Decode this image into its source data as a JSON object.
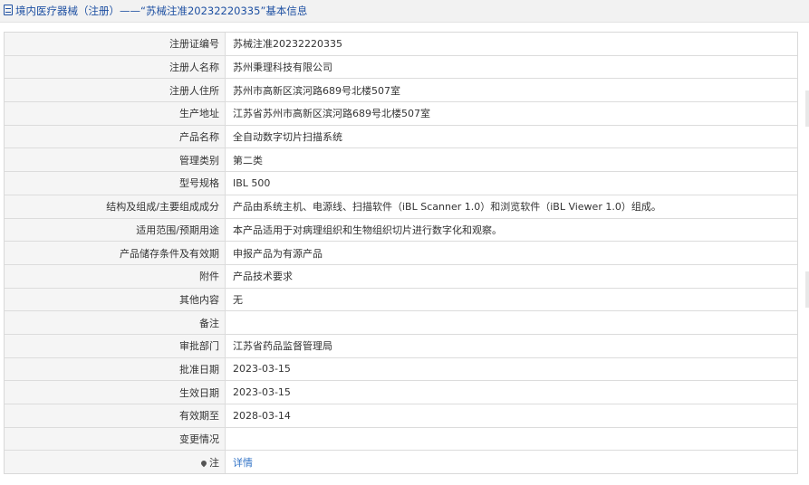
{
  "header": {
    "title": "境内医疗器械（注册）——“苏械注准20232220335”基本信息"
  },
  "rows": [
    {
      "label": "注册证编号",
      "value": "苏械注准20232220335"
    },
    {
      "label": "注册人名称",
      "value": "苏州秉理科技有限公司"
    },
    {
      "label": "注册人住所",
      "value": "苏州市高新区滨河路689号北楼507室"
    },
    {
      "label": "生产地址",
      "value": "江苏省苏州市高新区滨河路689号北楼507室"
    },
    {
      "label": "产品名称",
      "value": "全自动数字切片扫描系统"
    },
    {
      "label": "管理类别",
      "value": "第二类"
    },
    {
      "label": "型号规格",
      "value": "IBL 500"
    },
    {
      "label": "结构及组成/主要组成成分",
      "value": "产品由系统主机、电源线、扫描软件（iBL Scanner 1.0）和浏览软件（iBL Viewer 1.0）组成。"
    },
    {
      "label": "适用范围/预期用途",
      "value": "本产品适用于对病理组织和生物组织切片进行数字化和观察。"
    },
    {
      "label": "产品储存条件及有效期",
      "value": "申报产品为有源产品"
    },
    {
      "label": "附件",
      "value": "产品技术要求"
    },
    {
      "label": "其他内容",
      "value": "无"
    },
    {
      "label": "备注",
      "value": ""
    },
    {
      "label": "审批部门",
      "value": "江苏省药品监督管理局"
    },
    {
      "label": "批准日期",
      "value": "2023-03-15"
    },
    {
      "label": "生效日期",
      "value": "2023-03-15"
    },
    {
      "label": "有效期至",
      "value": "2028-03-14"
    },
    {
      "label": "变更情况",
      "value": ""
    },
    {
      "label": "注",
      "value": "详情"
    }
  ]
}
